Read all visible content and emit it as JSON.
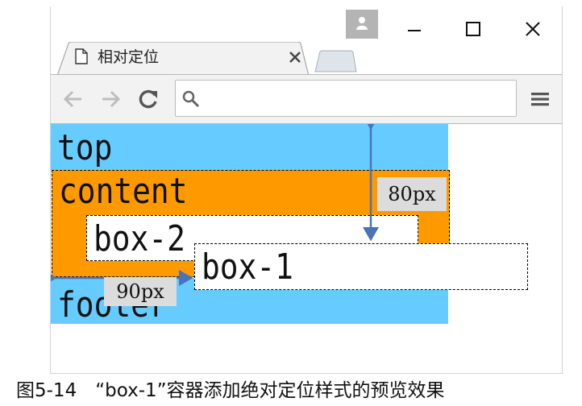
{
  "tab": {
    "title": "相对定位"
  },
  "omnibox": {
    "value": ""
  },
  "page": {
    "top_text": "top",
    "content_text": "content",
    "box2_text": "box-2",
    "box1_text": "box-1",
    "footer_text": "footer",
    "colors": {
      "header_footer": "#66ccff",
      "content": "#ff9900",
      "box": "#ffffff"
    }
  },
  "annotations": {
    "vertical_offset_label": "80px",
    "horizontal_offset_label": "90px",
    "arrow_color": "#4a73b8"
  },
  "caption": "图5-14　“box-1”容器添加绝对定位样式的预览效果",
  "icons": [
    "user-icon",
    "minimize-icon",
    "maximize-icon",
    "close-icon",
    "page-icon",
    "tab-close-icon",
    "back-arrow-icon",
    "forward-arrow-icon",
    "reload-icon",
    "search-icon",
    "menu-icon"
  ]
}
